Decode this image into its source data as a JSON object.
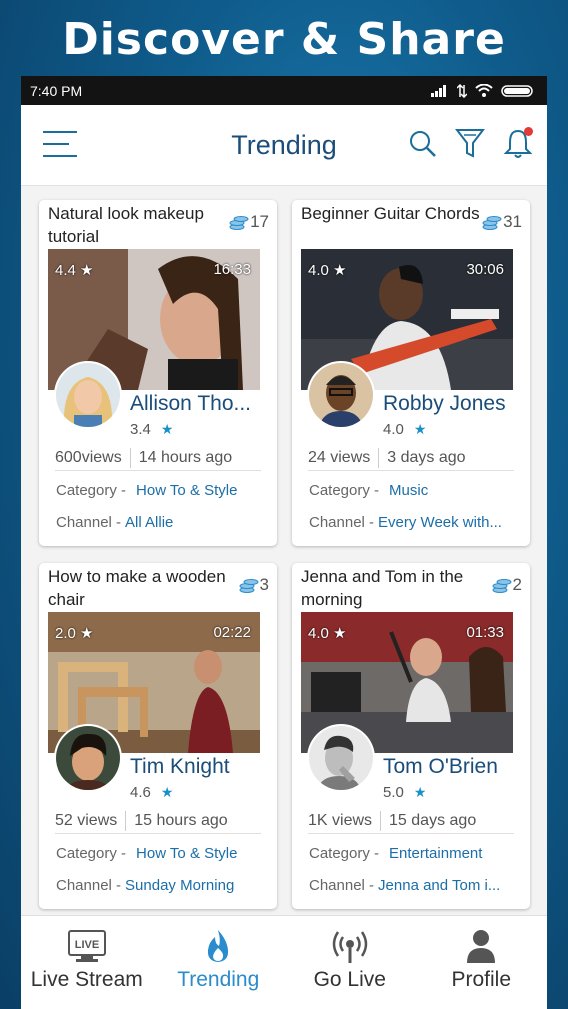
{
  "hero": {
    "title": "Discover & Share"
  },
  "status": {
    "time": "7:40 PM"
  },
  "appbar": {
    "title": "Trending"
  },
  "cards": [
    {
      "title": "Natural look makeup tutorial",
      "coins": "17",
      "rating": "4.4 ★",
      "duration": "16:33",
      "uploader": "Allison Tho...",
      "user_rating": "3.4",
      "views": "600views",
      "time": "14 hours ago",
      "category_label": "Category -",
      "category": "How To & Style",
      "channel_label": "Channel -",
      "channel": "All Allie"
    },
    {
      "title": "Beginner Guitar Chords",
      "coins": "31",
      "rating": "4.0 ★",
      "duration": "30:06",
      "uploader": "Robby Jones",
      "user_rating": "4.0",
      "views": "24 views",
      "time": "3 days ago",
      "category_label": "Category -",
      "category": "Music",
      "channel_label": "Channel -",
      "channel": "Every Week with..."
    },
    {
      "title": "How to make a wooden chair",
      "coins": "3",
      "rating": "2.0 ★",
      "duration": "02:22",
      "uploader": "Tim Knight",
      "user_rating": "4.6",
      "views": "52 views",
      "time": "15 hours ago",
      "category_label": "Category -",
      "category": "How To & Style",
      "channel_label": "Channel -",
      "channel": "Sunday Morning"
    },
    {
      "title": "Jenna and Tom in the morning",
      "coins": "2",
      "rating": "4.0 ★",
      "duration": "01:33",
      "uploader": "Tom O'Brien",
      "user_rating": "5.0",
      "views": "1K views",
      "time": "15 days ago",
      "category_label": "Category -",
      "category": "Entertainment",
      "channel_label": "Channel -",
      "channel": "Jenna and Tom i..."
    }
  ],
  "nav": {
    "live_badge": "LIVE",
    "items": [
      {
        "label": "Live Stream",
        "icon": "tv-live-icon"
      },
      {
        "label": "Trending",
        "icon": "flame-icon"
      },
      {
        "label": "Go Live",
        "icon": "broadcast-icon"
      },
      {
        "label": "Profile",
        "icon": "person-icon"
      }
    ]
  },
  "colors": {
    "accent": "#2a8ccc",
    "title": "#1a4d7a",
    "link": "#1b6ea8",
    "notification": "#e53935"
  }
}
